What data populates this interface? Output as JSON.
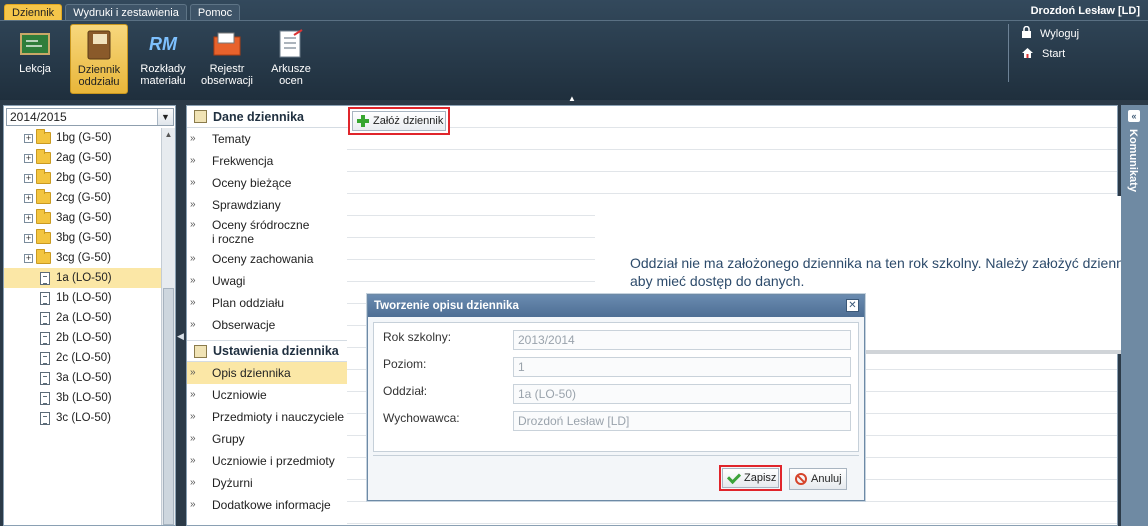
{
  "top_tabs": [
    "Dziennik",
    "Wydruki i zestawienia",
    "Pomoc"
  ],
  "user": "Drozdoń Lesław [LD]",
  "ribbon": [
    {
      "label": "Lekcja"
    },
    {
      "label": "Dziennik oddziału",
      "active": true
    },
    {
      "label": "Rozkłady materiału",
      "icon_text": "RM"
    },
    {
      "label": "Rejestr obserwacji"
    },
    {
      "label": "Arkusze ocen"
    }
  ],
  "side_links": {
    "logout": "Wyloguj",
    "start": "Start"
  },
  "left": {
    "year": "2014/2015",
    "tree": [
      {
        "label": "1bg (G-50)",
        "type": "folder"
      },
      {
        "label": "2ag (G-50)",
        "type": "folder"
      },
      {
        "label": "2bg (G-50)",
        "type": "folder"
      },
      {
        "label": "2cg (G-50)",
        "type": "folder"
      },
      {
        "label": "3ag (G-50)",
        "type": "folder"
      },
      {
        "label": "3bg (G-50)",
        "type": "folder"
      },
      {
        "label": "3cg (G-50)",
        "type": "folder"
      },
      {
        "label": "1a (LO-50)",
        "type": "file",
        "selected": true
      },
      {
        "label": "1b (LO-50)",
        "type": "file"
      },
      {
        "label": "2a (LO-50)",
        "type": "file"
      },
      {
        "label": "2b (LO-50)",
        "type": "file"
      },
      {
        "label": "2c (LO-50)",
        "type": "file"
      },
      {
        "label": "3a (LO-50)",
        "type": "file"
      },
      {
        "label": "3b (LO-50)",
        "type": "file"
      },
      {
        "label": "3c (LO-50)",
        "type": "file"
      }
    ]
  },
  "nav": {
    "section1": "Dane dziennika",
    "section1_items": [
      "Tematy",
      "Frekwencja",
      "Oceny bieżące",
      "Sprawdziany",
      "Oceny śródroczne\ni roczne",
      "Oceny zachowania",
      "Uwagi",
      "Plan oddziału",
      "Obserwacje"
    ],
    "section2": "Ustawienia dziennika",
    "section2_items": [
      "Opis dziennika",
      "Uczniowie",
      "Przedmioty i nauczyciele",
      "Grupy",
      "Uczniowie i przedmioty",
      "Dyżurni",
      "Dodatkowe informacje"
    ],
    "selected": "Opis dziennika"
  },
  "content": {
    "create_button": "Załóż dziennik",
    "message": "Oddział nie ma założonego dziennika na ten rok szkolny. Należy założyć dziennik aby mieć dostęp do danych."
  },
  "right_rail": "Komunikaty",
  "dialog": {
    "title": "Tworzenie opisu dziennika",
    "fields": [
      {
        "label": "Rok szkolny:",
        "value": "2013/2014"
      },
      {
        "label": "Poziom:",
        "value": "1"
      },
      {
        "label": "Oddział:",
        "value": "1a (LO-50)"
      },
      {
        "label": "Wychowawca:",
        "value": "Drozdoń Lesław [LD]"
      }
    ],
    "save": "Zapisz",
    "cancel": "Anuluj"
  }
}
